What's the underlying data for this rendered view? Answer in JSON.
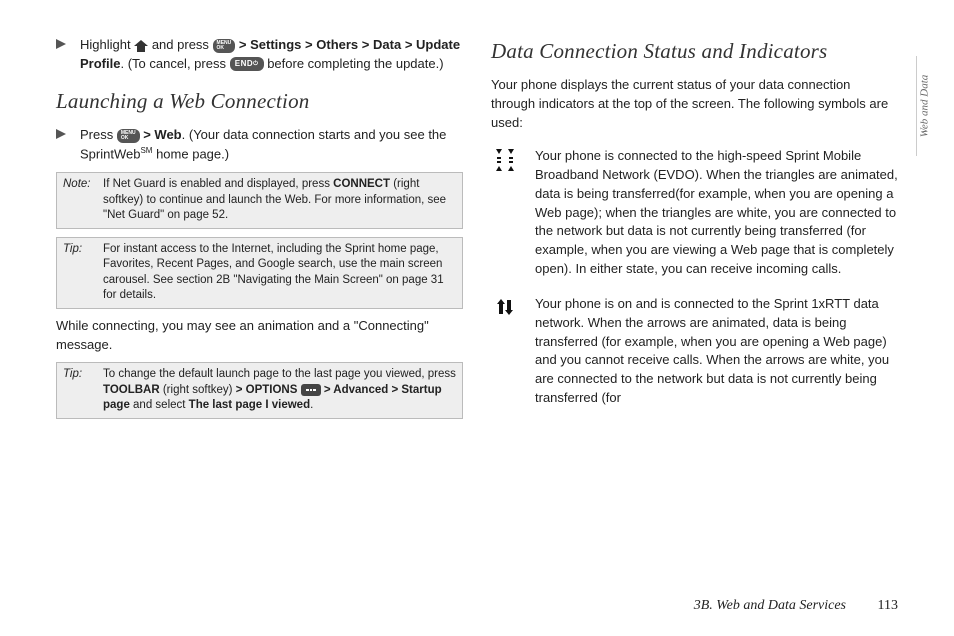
{
  "sideTab": "Web and Data",
  "footer": {
    "section": "3B. Web and Data Services",
    "page": "113"
  },
  "left": {
    "step1": {
      "prefix": "Highlight ",
      "pressWord": " and press ",
      "chev": ">",
      "seg1": "Settings",
      "seg2": "Others",
      "seg3": "Data",
      "seg4": "Update Profile",
      "cancel": ". (To cancel, press ",
      "endKey": "END",
      "after": " before completing the update.)"
    },
    "heading1": "Launching a Web Connection",
    "step2": {
      "prefix": "Press ",
      "chev": ">",
      "web": "Web",
      "rest1": ". (Your data connection starts and you see the SprintWeb",
      "sm": "SM",
      "rest2": " home page.)"
    },
    "note": {
      "label": "Note:",
      "body1": "If Net Guard is enabled and displayed, press ",
      "connect": "CONNECT",
      "body2": " (right softkey) to continue and launch the Web. For more information, see \"Net Guard\" on page 52."
    },
    "tip1": {
      "label": "Tip:",
      "body": "For instant access to the Internet, including the Sprint home page, Favorites, Recent Pages, and Google search, use the main screen carousel. See section 2B \"Navigating the Main Screen\" on page 31 for details."
    },
    "connectingPara": "While connecting, you may see an animation and a \"Connecting\" message.",
    "tip2": {
      "label": "Tip:",
      "p1": "To change the default launch page to the last page you viewed, press ",
      "toolbar": "TOOLBAR",
      "p2": " (right softkey) ",
      "chev": ">",
      "options": "OPTIONS",
      "advanced": "Advanced",
      "startup": "Startup page",
      "sel": " and select ",
      "last": "The last page I viewed",
      "period": "."
    }
  },
  "right": {
    "heading": "Data Connection Status and Indicators",
    "intro": "Your phone displays the current status of your data connection through indicators at the top of the screen. The following symbols are used:",
    "symbol1": "Your phone is connected to the high-speed Sprint Mobile Broadband Network (EVDO). When the triangles are animated, data is being transferred(for example, when you are opening a Web page); when the triangles are white, you are connected to the network but data is not currently being transferred (for example, when you are viewing a Web page that is completely open). In either state, you can receive incoming calls.",
    "symbol2": "Your phone is on and is connected to the Sprint 1xRTT data network. When the arrows are animated, data is being transferred (for example, when you are opening a Web page) and you cannot receive calls. When the arrows are white, you are connected to the network but data is not currently being transferred (for"
  },
  "keys": {
    "ok": "MENU\nOK"
  }
}
